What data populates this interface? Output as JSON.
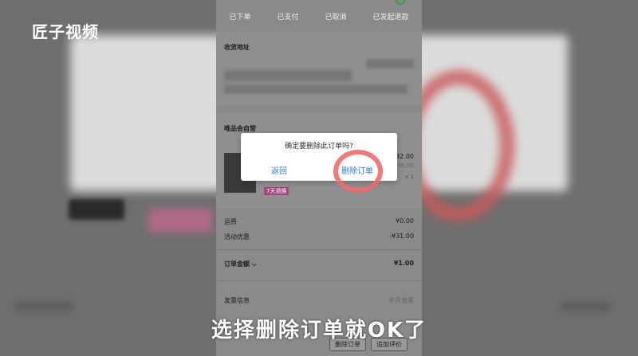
{
  "watermark": "匠子视频",
  "order_status_tabs": [
    "已下单",
    "已支付",
    "已取消",
    "已发起退款"
  ],
  "address": {
    "title": "收货地址"
  },
  "store": {
    "title": "唯品会自营"
  },
  "goods": {
    "price": "¥32.00",
    "original_price": "¥95.00",
    "quantity": "x 1",
    "tag": "7天退换"
  },
  "fees": [
    {
      "label": "运费",
      "value": "¥0.00"
    },
    {
      "label": "活动优惠",
      "value": "-¥31.00"
    }
  ],
  "order_total": {
    "label": "订单金额",
    "value": "¥1.00"
  },
  "invoice": {
    "label": "发票信息",
    "value": "不开发票"
  },
  "bottom_buttons": [
    "删除订单",
    "追加评价"
  ],
  "dialog": {
    "message": "确定要删除此订单吗?",
    "back_label": "返回",
    "delete_label": "删除订单"
  },
  "subtitle": "选择删除订单就OK了",
  "colors": {
    "dialog_button": "#2c7de0",
    "highlight_ring": "#f06a6a",
    "tag": "#a3467a"
  }
}
